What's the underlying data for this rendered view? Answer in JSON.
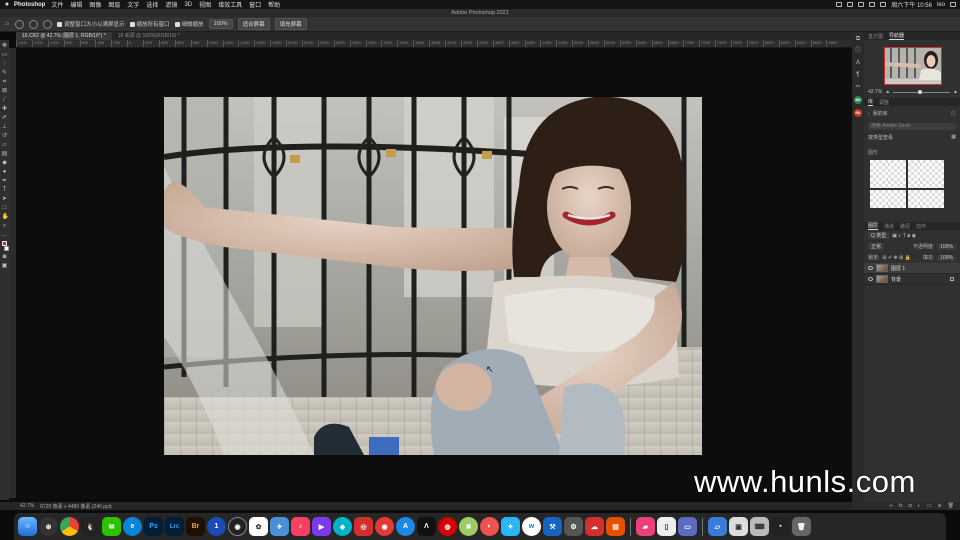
{
  "menubar": {
    "app_name": "Photoshop",
    "items": [
      "文件",
      "编辑",
      "图像",
      "图层",
      "文字",
      "选择",
      "滤镜",
      "3D",
      "视图",
      "增效工具",
      "窗口",
      "帮助"
    ],
    "clock": "周六下午 10:56",
    "user": "leo"
  },
  "window": {
    "title": "Adobe Photoshop 2021"
  },
  "options": {
    "resize_windows": "调整窗口大小以满屏显示",
    "zoom_all": "缩放所有窗口",
    "scrubby_zoom": "细微缩放",
    "zoom_100": "100%",
    "fit_screen": "适合屏幕",
    "fill_screen": "填充屏幕"
  },
  "tabs": [
    {
      "label": "16.CR2 @ 42.7% (图层 1, RGB/16*) *",
      "active": true
    },
    {
      "label": "18 来源 @ 100%(RGB/16) *",
      "active": false
    }
  ],
  "ruler": {
    "labels": [
      "1400",
      "1200",
      "1000",
      "800",
      "600",
      "400",
      "200",
      "0",
      "200",
      "400",
      "600",
      "800",
      "1000",
      "1200",
      "1400",
      "1600",
      "1800",
      "2000",
      "2200",
      "2400",
      "2600",
      "2800",
      "3000",
      "3200",
      "3400",
      "3600",
      "3800",
      "4000",
      "4200",
      "4400",
      "4600",
      "4800",
      "5000",
      "5200",
      "5400",
      "5600",
      "5800",
      "6000",
      "6200",
      "6400",
      "6600",
      "6800",
      "7000",
      "7200",
      "7400",
      "7600",
      "7800",
      "8000",
      "8200",
      "8400",
      "8600",
      "8800"
    ]
  },
  "status": {
    "zoom": "42.7%",
    "doc_info": "6720 像素 x 4480 像素 (240 ppi)"
  },
  "navigator": {
    "tabs": [
      "直方图",
      "导航器"
    ],
    "active_tab": "导航器",
    "zoom_value": "42.7%",
    "zoom_fraction": 0.43
  },
  "libraries": {
    "tabs": [
      "库",
      "调整"
    ],
    "library_name": "我的库",
    "search_placeholder": "搜索 Adobe Stock",
    "view_label": "按类型查看",
    "group_label": "图形"
  },
  "layers_panel": {
    "tabs": [
      "图层",
      "通道",
      "路径",
      "动作"
    ],
    "filter": "Q 类型",
    "blend_mode": "正常",
    "opacity_label": "不透明度:",
    "opacity": "100%",
    "lock_label": "锁定:",
    "fill_label": "填充:",
    "fill": "100%",
    "layers": [
      {
        "name": "图层 1",
        "selected": true,
        "locked": false
      },
      {
        "name": "背景",
        "selected": false,
        "locked": true
      }
    ]
  },
  "right_strip_badges": [
    "BA",
    "RA"
  ],
  "watermark": "www.hunls.com",
  "dock": {
    "apps": [
      "finder-icon",
      "launchpad-icon",
      "chrome-icon",
      "qq-icon",
      "wechat-icon",
      "edge-icon",
      "photoshop-icon",
      "lightroom-icon",
      "bridge-icon",
      "onepassword-icon",
      "obs-icon",
      "photos-icon",
      "mail-icon",
      "music-icon",
      "final-cut-icon",
      "video-icon",
      "app-store-icon",
      "settings-icon"
    ],
    "labels": {
      "ps": "Ps",
      "lrc": "Lrc",
      "br": "Br"
    }
  },
  "colors": {
    "accent": "#c53c2e",
    "panel_bg": "#303030",
    "canvas_bg": "#0d0d0d",
    "badge_ba": "#2e8b57",
    "badge_ra": "#c0392b"
  }
}
